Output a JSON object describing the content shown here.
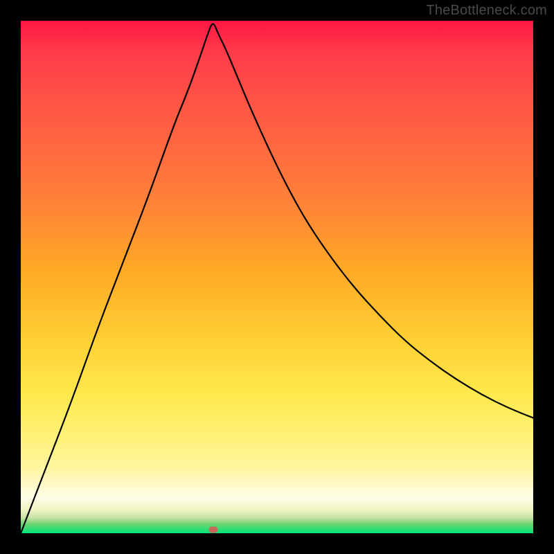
{
  "watermark": {
    "text": "TheBottleneck.com"
  },
  "marker": {
    "x_frac": 0.375,
    "y_frac": 0.993,
    "color": "#c56a5b"
  },
  "chart_data": {
    "type": "line",
    "title": "",
    "xlabel": "",
    "ylabel": "",
    "xlim": [
      0,
      1
    ],
    "ylim": [
      0,
      1
    ],
    "series": [
      {
        "name": "curve",
        "x": [
          0.0,
          0.05,
          0.1,
          0.15,
          0.2,
          0.25,
          0.3,
          0.325,
          0.35,
          0.365,
          0.375,
          0.385,
          0.4,
          0.425,
          0.45,
          0.5,
          0.55,
          0.6,
          0.65,
          0.7,
          0.75,
          0.8,
          0.85,
          0.9,
          0.95,
          1.0
        ],
        "y": [
          0.0,
          0.13,
          0.26,
          0.4,
          0.53,
          0.66,
          0.8,
          0.86,
          0.93,
          0.975,
          1.0,
          0.975,
          0.945,
          0.885,
          0.825,
          0.715,
          0.62,
          0.545,
          0.48,
          0.425,
          0.375,
          0.335,
          0.3,
          0.27,
          0.245,
          0.225
        ]
      }
    ],
    "gradient_stops": [
      {
        "pos": 0.0,
        "color": "#ff1744"
      },
      {
        "pos": 0.06,
        "color": "#ff3b4a"
      },
      {
        "pos": 0.18,
        "color": "#ff5945"
      },
      {
        "pos": 0.34,
        "color": "#ff7e3a"
      },
      {
        "pos": 0.48,
        "color": "#ffa726"
      },
      {
        "pos": 0.62,
        "color": "#ffcf33"
      },
      {
        "pos": 0.73,
        "color": "#ffe94d"
      },
      {
        "pos": 0.81,
        "color": "#fff176"
      },
      {
        "pos": 0.87,
        "color": "#fff59d"
      },
      {
        "pos": 0.93,
        "color": "#fffde7"
      },
      {
        "pos": 0.955,
        "color": "#f0f4c3"
      },
      {
        "pos": 0.97,
        "color": "#c5e1a5"
      },
      {
        "pos": 0.983,
        "color": "#66d36f"
      },
      {
        "pos": 1.0,
        "color": "#00e676"
      }
    ],
    "marker": {
      "x": 0.375,
      "y": 1.0,
      "color": "#c56a5b"
    }
  }
}
